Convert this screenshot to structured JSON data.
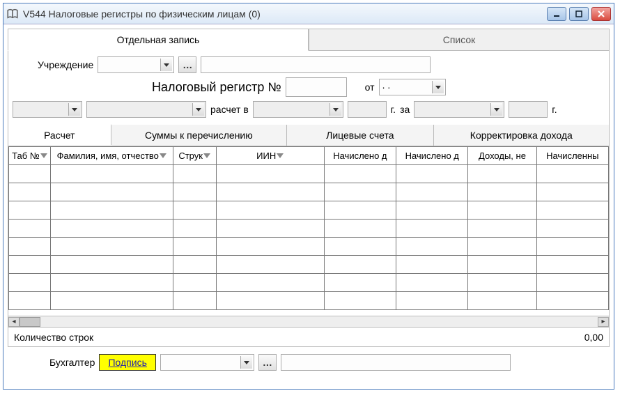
{
  "window": {
    "title": "V544 Налоговые регистры по физическим лицам (0)"
  },
  "main_tabs": {
    "single": "Отдельная запись",
    "list": "Список"
  },
  "form": {
    "institution_label": "Учреждение",
    "register_label": "Налоговый регистр №",
    "from_label": "от",
    "date_value": " .  . ",
    "calc_in_label": "расчет в",
    "year_suffix_1": "г.",
    "for_label": "за",
    "year_suffix_2": "г."
  },
  "sub_tabs": {
    "calc": "Расчет",
    "sums": "Суммы к перечислению",
    "accounts": "Лицевые счета",
    "correction": "Корректировка дохода"
  },
  "grid": {
    "columns": [
      "Таб №",
      "Фамилия, имя, отчество",
      "Струк",
      "ИИН",
      "Начислено д",
      "Начислено д",
      "Доходы, не",
      "Начисленны"
    ],
    "row_count_label": "Количество строк",
    "row_count_value": "0,00"
  },
  "footer": {
    "accountant_label": "Бухгалтер",
    "sign_label": "Подпись"
  }
}
